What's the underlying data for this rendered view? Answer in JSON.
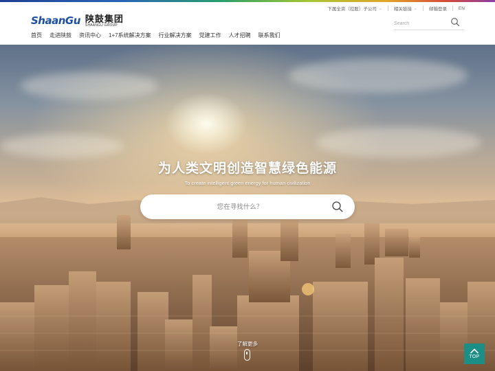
{
  "logo": {
    "en": "ShaanGu",
    "cn": "陕鼓集团",
    "sub": "SHAANGU GROUP"
  },
  "top_links": [
    {
      "label": "下属全资（控股）子公司"
    },
    {
      "label": "相关链接"
    },
    {
      "label": "邮箱登录"
    },
    {
      "label": "EN"
    }
  ],
  "search": {
    "placeholder": "Search",
    "icon": "search-icon"
  },
  "nav": [
    "首页",
    "走进陕鼓",
    "资讯中心",
    "1+7系统解决方案",
    "行业解决方案",
    "党建工作",
    "人才招聘",
    "联系我们"
  ],
  "hero": {
    "title": "为人类文明创造智慧绿色能源",
    "subtitle": "To create intelligent green energy for human civilization",
    "search_placeholder": "您在寻找什么？",
    "more_label": "了解更多"
  },
  "back_to_top": {
    "label": "TOP",
    "color": "#1b8e86"
  },
  "colors": {
    "brand_blue": "#1f4fa1",
    "accent_teal": "#1b8e86"
  }
}
